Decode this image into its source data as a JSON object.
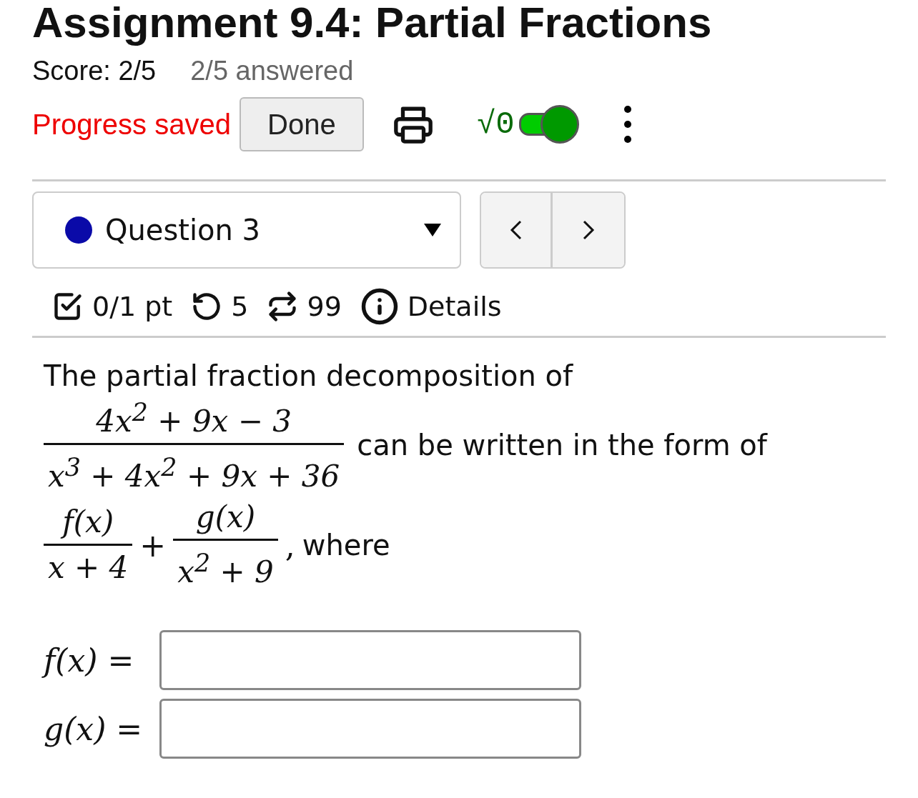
{
  "header": {
    "title": "Assignment 9.4: Partial Fractions",
    "score": "Score: 2/5",
    "answered": "2/5 answered"
  },
  "toolbar": {
    "status": "Progress saved",
    "done_button": "Done",
    "math_toggle": {
      "label": "√0",
      "on": true
    }
  },
  "question_nav": {
    "selector": {
      "label": "Question 3",
      "color": "#0a0aa8"
    }
  },
  "question_meta": [
    {
      "kind": "points",
      "text": "0/1 pt"
    },
    {
      "kind": "retries",
      "text": "5"
    },
    {
      "kind": "attempts",
      "text": "99"
    },
    {
      "kind": "details",
      "text": "Details"
    }
  ],
  "question": {
    "intro": "The partial fraction decomposition of",
    "fraction": {
      "numerator": "4x$^{2}$ + 9x − 3",
      "denominator": "x$^{3}$ + 4x$^{2}$ + 9x + 36"
    },
    "form_text": "can be written in the form of",
    "terms": [
      {
        "numerator": "f(x)",
        "denominator": "x + 4"
      },
      {
        "numerator": "g(x)",
        "denominator": "x$^{2}$ + 9"
      }
    ],
    "plus": "+",
    "comma": ",",
    "where": "where",
    "answers": [
      {
        "label": "f(x) ="
      },
      {
        "label": "g(x) ="
      }
    ]
  }
}
